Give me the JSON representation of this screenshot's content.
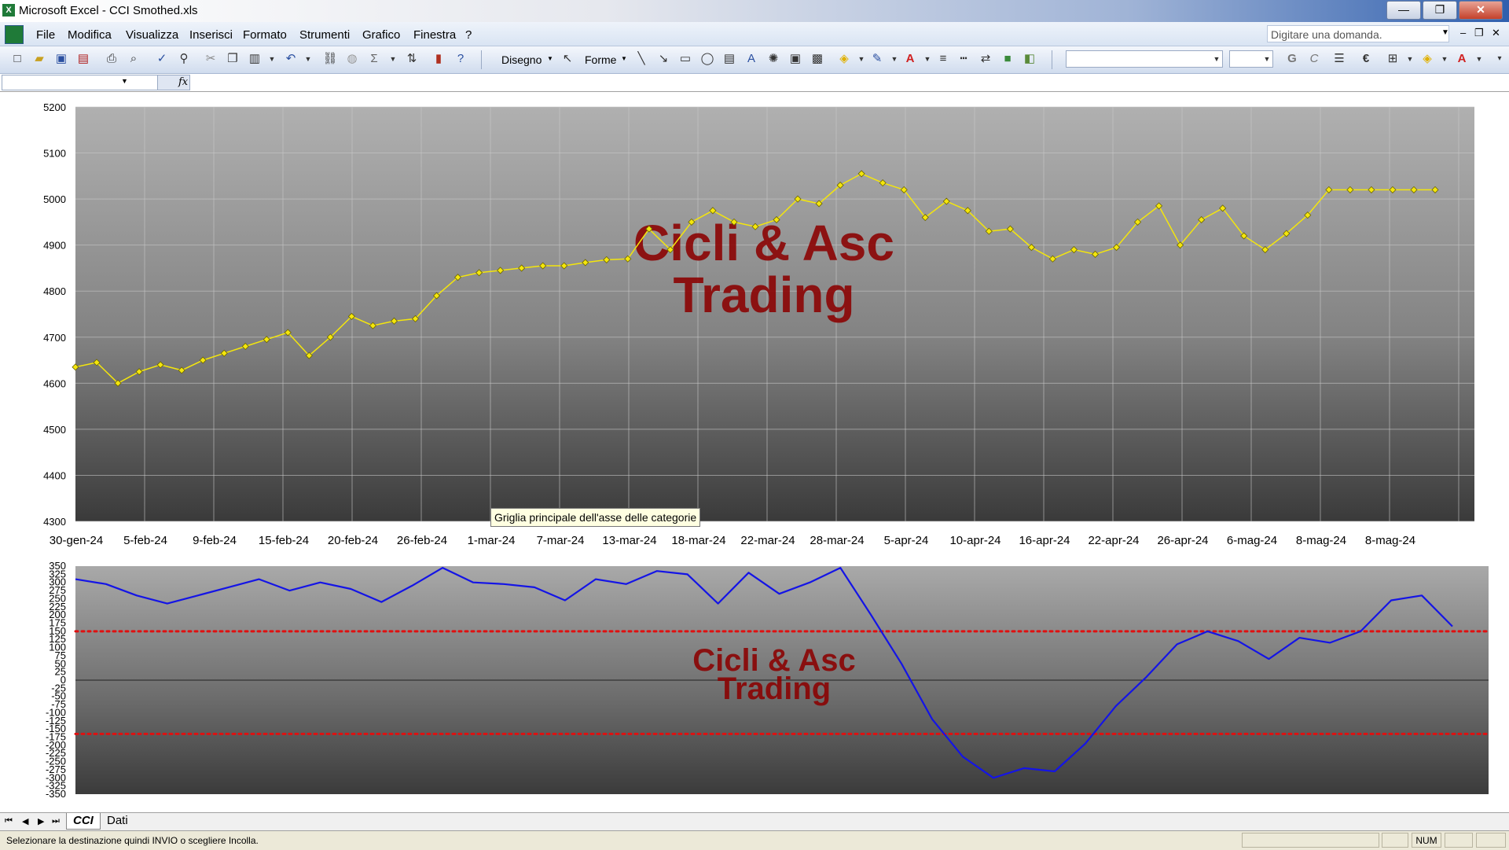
{
  "window": {
    "title": "Microsoft Excel - CCI Smothed.xls",
    "app_icon": "X"
  },
  "window_buttons": {
    "minimize": "—",
    "restore": "❐",
    "close": "✕"
  },
  "menu": {
    "items": [
      "File",
      "Modifica",
      "Visualizza",
      "Inserisci",
      "Formato",
      "Strumenti",
      "Grafico",
      "Finestra",
      "?"
    ],
    "ask_placeholder": "Digitare una domanda.",
    "doc_controls": {
      "minimize": "–",
      "restore": "❐",
      "close": "✕"
    }
  },
  "toolbar": {
    "draw_label": "Disegno",
    "shapes_label": "Forme",
    "bold": "G",
    "italic": "C",
    "euro": "€"
  },
  "formula_bar": {
    "fx": "fx"
  },
  "tooltip": "Griglia principale dell'asse delle categorie",
  "sheet_tabs": {
    "active": "CCI",
    "other": "Dati"
  },
  "status_bar": {
    "message": "Selezionare la destinazione quindi INVIO o scegliere Incolla.",
    "num": "NUM"
  },
  "colors": {
    "price_series": "#f4e60c",
    "cci_series": "#1414e6",
    "threshold": "#e01010",
    "watermark": "#8b0000"
  },
  "chart_data": [
    {
      "type": "line",
      "title": "",
      "watermark": [
        "Cicli & Asc",
        "Trading"
      ],
      "ylim": [
        4300,
        5200
      ],
      "yticks": [
        4300,
        4400,
        4500,
        4600,
        4700,
        4800,
        4900,
        5000,
        5100,
        5200
      ],
      "x_labels": [
        "30-gen-24",
        "5-feb-24",
        "9-feb-24",
        "15-feb-24",
        "20-feb-24",
        "26-feb-24",
        "1-mar-24",
        "7-mar-24",
        "13-mar-24",
        "18-mar-24",
        "22-mar-24",
        "28-mar-24",
        "5-apr-24",
        "10-apr-24",
        "16-apr-24",
        "22-apr-24",
        "26-apr-24",
        "6-mag-24",
        "8-mag-24",
        "8-mag-24"
      ],
      "grid": true,
      "series": [
        {
          "values": [
            4635,
            4645,
            4600,
            4625,
            4640,
            4628,
            4650,
            4665,
            4680,
            4695,
            4710,
            4660,
            4700,
            4745,
            4725,
            4735,
            4740,
            4790,
            4830,
            4840,
            4845,
            4850,
            4855,
            4855,
            4862,
            4868,
            4870,
            4935,
            4890,
            4950,
            4975,
            4950,
            4940,
            4955,
            5000,
            4990,
            5030,
            5055,
            5035,
            5020,
            4960,
            4995,
            4975,
            4930,
            4935,
            4895,
            4870,
            4890,
            4880,
            4895,
            4950,
            4985,
            4900,
            4955,
            4980,
            4920,
            4890,
            4925,
            4965,
            5020,
            5020,
            5020,
            5020,
            5020,
            5020
          ]
        }
      ]
    },
    {
      "type": "line",
      "title": "",
      "watermark": [
        "Cicli & Asc",
        "Trading"
      ],
      "ylim": [
        -350,
        350
      ],
      "yticks": [
        350,
        325,
        300,
        275,
        250,
        225,
        200,
        175,
        150,
        125,
        100,
        75,
        50,
        25,
        0,
        -25,
        -50,
        -75,
        -100,
        -125,
        -150,
        -175,
        -200,
        -225,
        -250,
        -275,
        -300,
        -325,
        -350
      ],
      "thresholds": [
        150,
        -165
      ],
      "grid": false,
      "series": [
        {
          "values": [
            310,
            295,
            260,
            235,
            260,
            285,
            310,
            275,
            300,
            280,
            240,
            290,
            345,
            300,
            295,
            285,
            245,
            310,
            295,
            335,
            325,
            235,
            330,
            265,
            300,
            345,
            200,
            50,
            -120,
            -235,
            -300,
            -270,
            -280,
            -195,
            -80,
            10,
            110,
            150,
            120,
            65,
            130,
            115,
            150,
            245,
            260,
            165
          ]
        }
      ]
    }
  ]
}
